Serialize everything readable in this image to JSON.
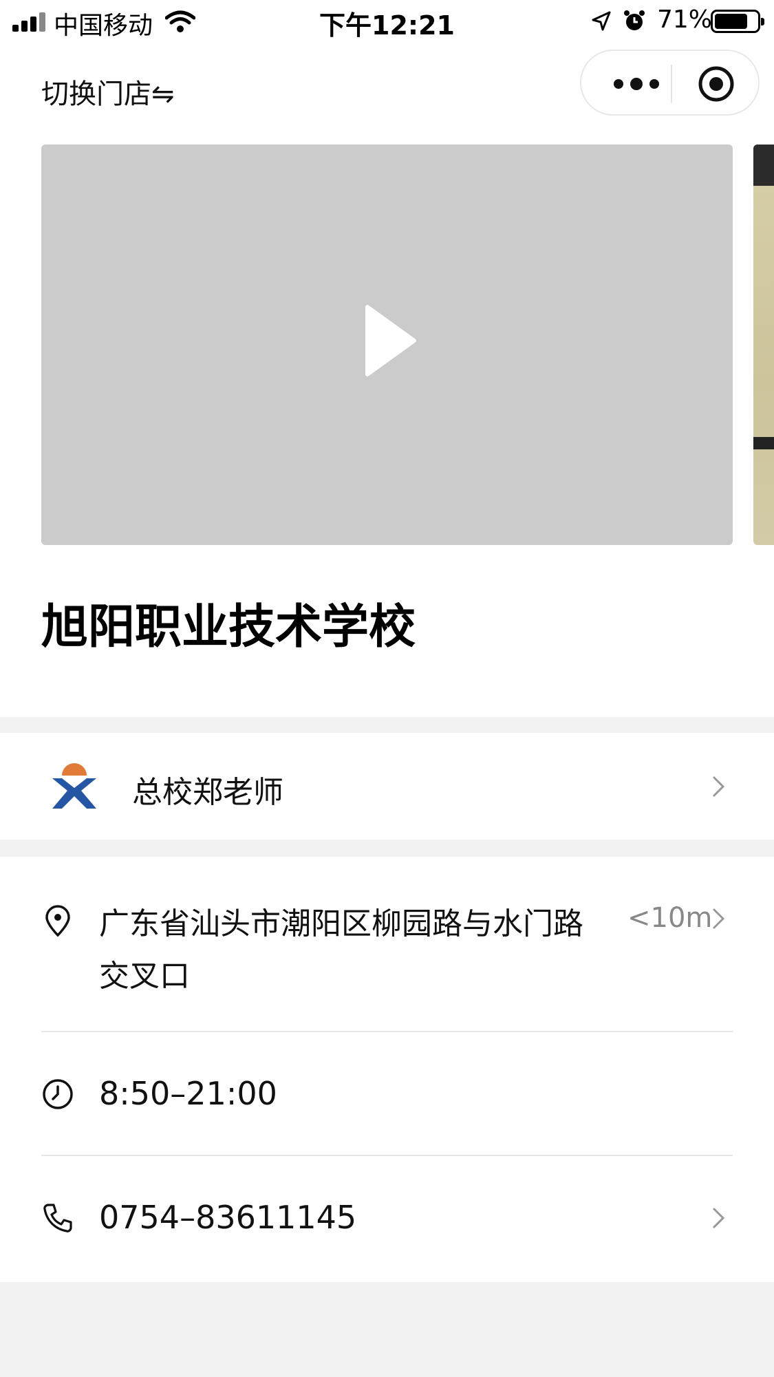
{
  "status_bar": {
    "carrier": "中国移动",
    "time": "下午12:21",
    "battery": "71%",
    "icons": [
      "signal-icon",
      "wifi-icon",
      "location-arrow-icon",
      "alarm-icon",
      "battery-icon"
    ]
  },
  "topbar": {
    "switch_store": "切换门店⇋",
    "capsule_icons": [
      "more-icon",
      "close-target-icon"
    ]
  },
  "hero": {
    "media": [
      "video",
      "image"
    ],
    "school_name": "旭阳职业技术学校"
  },
  "contact": {
    "name": "总校郑老师"
  },
  "info": {
    "address": "广东省汕头市潮阳区柳园路与水门路交叉口",
    "distance": "<10m",
    "hours": "8:50–21:00",
    "phone": "0754–83611145"
  },
  "colors": {
    "avatar_orange": "#e07b39",
    "avatar_blue": "#2456a4",
    "video_placeholder": "#cbcbcb",
    "page_bg": "#f2f2f2"
  }
}
